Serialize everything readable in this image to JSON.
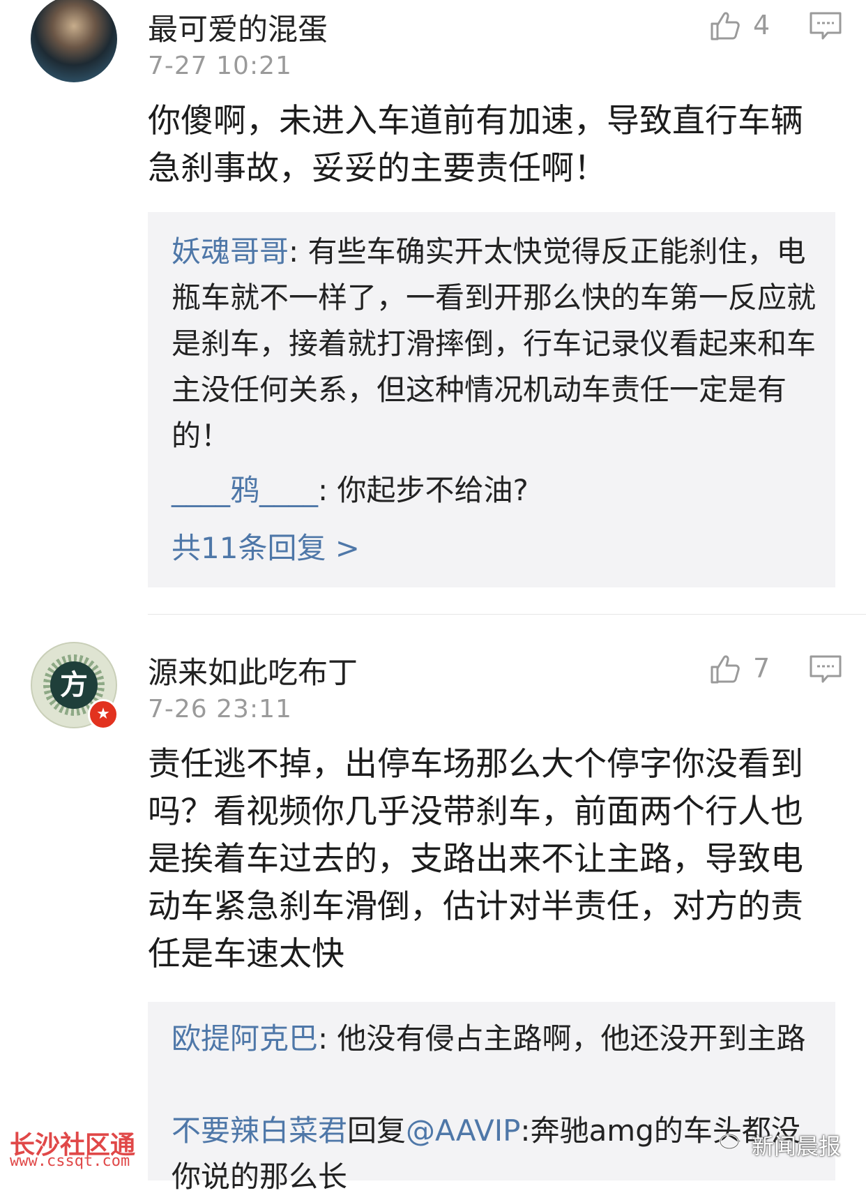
{
  "comments": [
    {
      "username": "最可爱的混蛋",
      "time": "7-27 10:21",
      "likes": "4",
      "text": "你傻啊，未进入车道前有加速，导致直行车辆急刹事故，妥妥的主要责任啊！",
      "replies": [
        {
          "name": "妖魂哥哥",
          "sep": ": ",
          "text": "有些车确实开太快觉得反正能刹住，电瓶车就不一样了，一看到开那么快的车第一反应就是刹车，接着就打滑摔倒，行车记录仪看起来和车主没任何关系，但这种情况机动车责任一定是有的！"
        },
        {
          "name": "____鸦____",
          "sep": ": ",
          "text": "你起步不给油?"
        }
      ],
      "more": "共11条回复 >"
    },
    {
      "username": "源来如此吃布丁",
      "time": "7-26 23:11",
      "likes": "7",
      "avatar_char": "方",
      "text": "责任逃不掉，出停车场那么大个停字你没看到吗？看视频你几乎没带刹车，前面两个行人也是挨着车过去的，支路出来不让主路，导致电动车紧急刹车滑倒，估计对半责任，对方的责任是车速太快",
      "replies": [
        {
          "name": "欧提阿克巴",
          "sep": ": ",
          "text": "他没有侵占主路啊，他还没开到主路"
        },
        {
          "name": "不要辣白菜君",
          "sep": "回复",
          "mention": "@AAVIP",
          "text": ":奔驰amg的车头都没你说的那么长"
        }
      ]
    }
  ],
  "watermarks": {
    "left_title": "长沙社区通",
    "left_url": "www.cssqt.com",
    "right": "新闻晨报"
  },
  "colors": {
    "name_link": "#4e77a8",
    "muted": "#9a9a9a",
    "reply_bg": "#f3f3f5",
    "badge": "#e2321f"
  }
}
